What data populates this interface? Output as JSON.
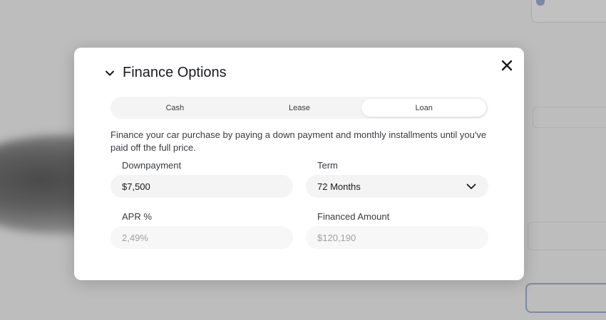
{
  "modal": {
    "title": "Finance Options",
    "tabs": [
      {
        "label": "Cash",
        "active": false
      },
      {
        "label": "Lease",
        "active": false
      },
      {
        "label": "Loan",
        "active": true
      }
    ],
    "description": "Finance your car purchase by paying a down payment and monthly installments until you've paid off the full price.",
    "fields": {
      "downpayment": {
        "label": "Downpayment",
        "value": "$7,500"
      },
      "term": {
        "label": "Term",
        "value": "72 Months"
      },
      "apr": {
        "label": "APR %",
        "value": "2,49%"
      },
      "financed_amount": {
        "label": "Financed Amount",
        "value": "$120,190"
      }
    },
    "icons": {
      "close": "close-icon",
      "collapse": "chevron-down-icon",
      "select": "chevron-down-icon"
    }
  },
  "colors": {
    "text": "#171a20",
    "muted": "#a0a0a0",
    "field_bg": "#f4f4f4",
    "accent": "#3e6ae1"
  }
}
